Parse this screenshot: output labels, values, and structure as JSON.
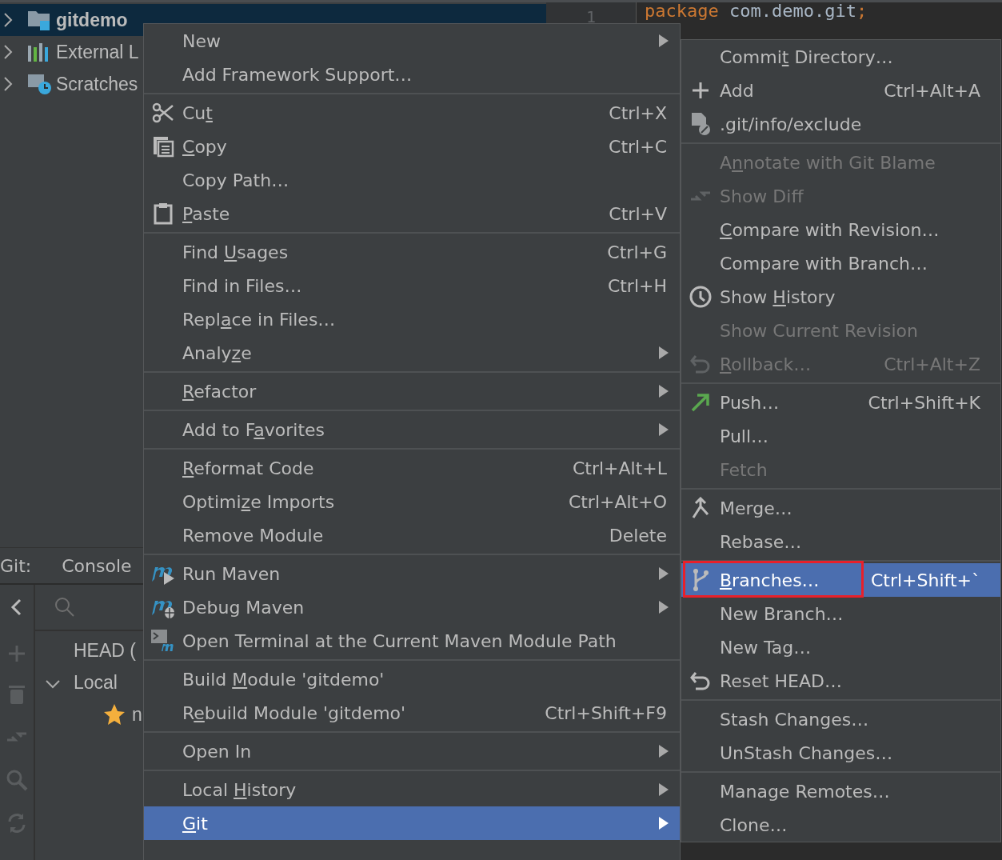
{
  "project_tree": [
    {
      "label": "gitdemo",
      "selected": true
    },
    {
      "label": "External L",
      "selected": false
    },
    {
      "label": "Scratches",
      "selected": false
    }
  ],
  "editor": {
    "line_number": "1",
    "tokens": [
      {
        "kind": "keyword",
        "text": "package"
      },
      {
        "kind": "plain",
        "text": " com.demo.git"
      },
      {
        "kind": "keyword",
        "text": ";"
      }
    ]
  },
  "git_panel": {
    "title": "Git:",
    "tabs": [
      {
        "label": "Console",
        "selected": false
      }
    ],
    "tree": [
      {
        "label": "HEAD ("
      },
      {
        "label": "Local",
        "expanded": true,
        "children": [
          {
            "label": "n",
            "kind": "current"
          }
        ]
      }
    ]
  },
  "context_menu": [
    [
      {
        "label": "New",
        "submenu": true,
        "disabled": false,
        "selected": false
      },
      {
        "label": "Add Framework Support…",
        "submenu": false,
        "disabled": false,
        "selected": false
      }
    ],
    [
      {
        "label_parts": {
          "pre": "Cu",
          "key": "t"
        },
        "shortcut": "Ctrl+X",
        "submenu": false,
        "disabled": false,
        "selected": false
      },
      {
        "label_parts": {
          "key": "C",
          "post": "opy"
        },
        "shortcut": "Ctrl+C",
        "submenu": false,
        "disabled": false,
        "selected": false
      },
      {
        "label": "Copy Path…",
        "submenu": false,
        "disabled": false,
        "selected": false
      },
      {
        "label_parts": {
          "key": "P",
          "post": "aste"
        },
        "shortcut": "Ctrl+V",
        "submenu": false,
        "disabled": false,
        "selected": false
      }
    ],
    [
      {
        "label_parts": {
          "pre": "Find ",
          "key": "U",
          "post": "sages"
        },
        "shortcut": "Ctrl+G",
        "submenu": false,
        "disabled": false,
        "selected": false
      },
      {
        "label": "Find in Files…",
        "shortcut": "Ctrl+H",
        "submenu": false,
        "disabled": false,
        "selected": false
      },
      {
        "label_parts": {
          "pre": "Repl",
          "key": "a",
          "post": "ce in Files…"
        },
        "submenu": false,
        "disabled": false,
        "selected": false
      },
      {
        "label_parts": {
          "pre": "Analy",
          "key": "z",
          "post": "e"
        },
        "submenu": true,
        "disabled": false,
        "selected": false
      }
    ],
    [
      {
        "label_parts": {
          "key": "R",
          "post": "efactor"
        },
        "submenu": true,
        "disabled": false,
        "selected": false
      }
    ],
    [
      {
        "label_parts": {
          "pre": "Add to F",
          "key": "a",
          "post": "vorites"
        },
        "submenu": true,
        "disabled": false,
        "selected": false
      }
    ],
    [
      {
        "label_parts": {
          "key": "R",
          "post": "eformat Code"
        },
        "shortcut": "Ctrl+Alt+L",
        "submenu": false,
        "disabled": false,
        "selected": false
      },
      {
        "label_parts": {
          "pre": "Optimi",
          "key": "z",
          "post": "e Imports"
        },
        "shortcut": "Ctrl+Alt+O",
        "submenu": false,
        "disabled": false,
        "selected": false
      },
      {
        "label": "Remove Module",
        "shortcut": "Delete",
        "submenu": false,
        "disabled": false,
        "selected": false
      }
    ],
    [
      {
        "label": "Run Maven",
        "submenu": true,
        "disabled": false,
        "selected": false
      },
      {
        "label": "Debug Maven",
        "submenu": true,
        "disabled": false,
        "selected": false
      },
      {
        "label": "Open Terminal at the Current Maven Module Path",
        "submenu": false,
        "disabled": false,
        "selected": false
      }
    ],
    [
      {
        "label_parts": {
          "pre": "Build ",
          "key": "M",
          "post": "odule 'gitdemo'"
        },
        "submenu": false,
        "disabled": false,
        "selected": false
      },
      {
        "label_parts": {
          "pre": "R",
          "key": "e",
          "post": "build Module 'gitdemo'"
        },
        "shortcut": "Ctrl+Shift+F9",
        "submenu": false,
        "disabled": false,
        "selected": false
      }
    ],
    [
      {
        "label": "Open In",
        "submenu": true,
        "disabled": false,
        "selected": false
      }
    ],
    [
      {
        "label_parts": {
          "pre": "Local ",
          "key": "H",
          "post": "istory"
        },
        "submenu": true,
        "disabled": false,
        "selected": false
      },
      {
        "label_parts": {
          "key": "G",
          "post": "it"
        },
        "submenu": true,
        "disabled": false,
        "selected": true
      }
    ]
  ],
  "git_menu": [
    [
      {
        "label_parts": {
          "pre": "Commi",
          "key": "t",
          "post": " Directory…"
        },
        "disabled": false,
        "selected": false,
        "annotated": false
      },
      {
        "label": "Add",
        "shortcut": "Ctrl+Alt+A",
        "disabled": false,
        "selected": false,
        "annotated": false
      },
      {
        "label": ".git/info/exclude",
        "disabled": false,
        "selected": false,
        "annotated": false
      }
    ],
    [
      {
        "label_parts": {
          "pre": "A",
          "key": "n",
          "post": "notate with Git Blame"
        },
        "disabled": true,
        "selected": false,
        "annotated": false
      },
      {
        "label": "Show Diff",
        "disabled": true,
        "selected": false,
        "annotated": false
      },
      {
        "label_parts": {
          "key": "C",
          "post": "ompare with Revision…"
        },
        "disabled": false,
        "selected": false,
        "annotated": false
      },
      {
        "label": "Compare with Branch…",
        "disabled": false,
        "selected": false,
        "annotated": false
      },
      {
        "label_parts": {
          "pre": "Show ",
          "key": "H",
          "post": "istory"
        },
        "disabled": false,
        "selected": false,
        "annotated": false
      },
      {
        "label": "Show Current Revision",
        "disabled": true,
        "selected": false,
        "annotated": false
      },
      {
        "label_parts": {
          "key": "R",
          "post": "ollback…"
        },
        "shortcut": "Ctrl+Alt+Z",
        "disabled": true,
        "selected": false,
        "annotated": false
      }
    ],
    [
      {
        "label": "Push…",
        "shortcut": "Ctrl+Shift+K",
        "disabled": false,
        "selected": false,
        "annotated": false
      },
      {
        "label": "Pull…",
        "disabled": false,
        "selected": false,
        "annotated": false
      },
      {
        "label": "Fetch",
        "disabled": true,
        "selected": false,
        "annotated": false
      }
    ],
    [
      {
        "label": "Merge…",
        "disabled": false,
        "selected": false,
        "annotated": false
      },
      {
        "label": "Rebase…",
        "disabled": false,
        "selected": false,
        "annotated": false
      }
    ],
    [
      {
        "label_parts": {
          "key": "B",
          "post": "ranches…"
        },
        "shortcut": "Ctrl+Shift+`",
        "disabled": false,
        "selected": true,
        "annotated": true
      },
      {
        "label": "New Branch…",
        "disabled": false,
        "selected": false,
        "annotated": false
      },
      {
        "label": "New Tag…",
        "disabled": false,
        "selected": false,
        "annotated": false
      },
      {
        "label": "Reset HEAD…",
        "disabled": false,
        "selected": false,
        "annotated": false
      }
    ],
    [
      {
        "label": "Stash Changes…",
        "disabled": false,
        "selected": false,
        "annotated": false
      },
      {
        "label": "UnStash Changes…",
        "disabled": false,
        "selected": false,
        "annotated": false
      }
    ],
    [
      {
        "label": "Manage Remotes…",
        "disabled": false,
        "selected": false,
        "annotated": false
      },
      {
        "label": "Clone…",
        "disabled": false,
        "selected": false,
        "annotated": false
      }
    ]
  ]
}
